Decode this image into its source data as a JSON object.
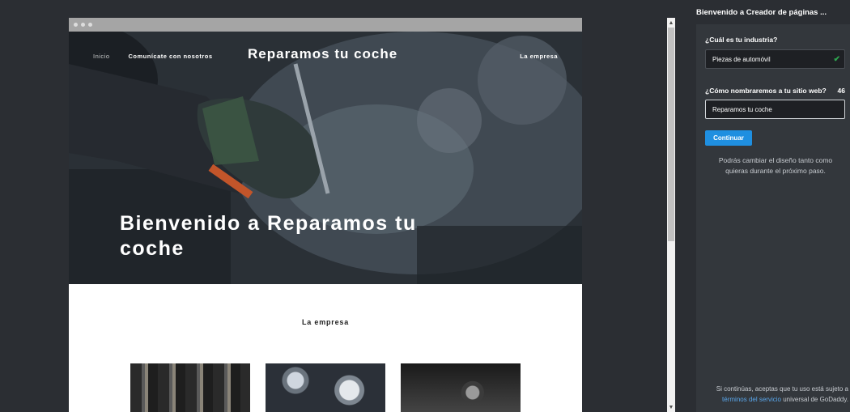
{
  "preview": {
    "nav": {
      "home": "Inicio",
      "contact": "Comunícate con nosotros",
      "site_title": "Reparamos tu coche",
      "company": "La empresa"
    },
    "hero_title": "Bienvenido a Reparamos tu coche",
    "section_title": "La empresa"
  },
  "panel": {
    "title": "Bienvenido a Creador de páginas ...",
    "industry_label": "¿Cuál es tu industria?",
    "industry_value": "Piezas de automóvil",
    "site_label": "¿Cómo nombraremos a tu sitio web?",
    "char_count": "46",
    "site_value": "Reparamos tu coche",
    "continue_label": "Continuar",
    "hint": "Podrás cambiar el diseño tanto como quieras durante el próximo paso.",
    "footer_before": "Si continúas, aceptas que tu uso está sujeto a",
    "footer_link": "términos del servicio",
    "footer_after": "universal de GoDaddy."
  },
  "colors": {
    "background": "#2b2e33",
    "panel": "#33373c",
    "accent": "#1f8fe0",
    "check": "#2ea44f",
    "link": "#5aa6ea"
  }
}
